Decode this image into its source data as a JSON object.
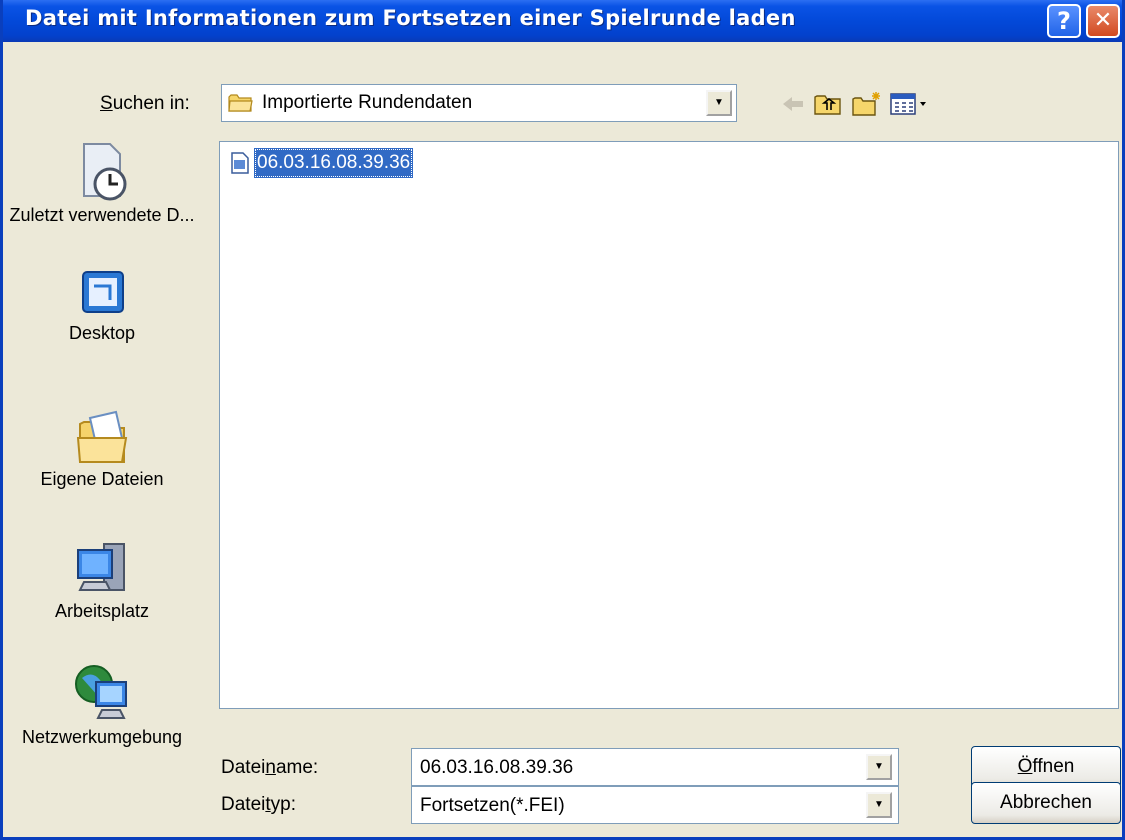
{
  "window": {
    "title": "Datei mit Informationen zum Fortsetzen einer Spielrunde laden",
    "help_label": "?",
    "close_label": "✕"
  },
  "lookin": {
    "label_pre": "",
    "label_key": "S",
    "label_post": "uchen in:",
    "value": "Importierte Rundendaten"
  },
  "toolbar": {
    "icons": [
      "back-arrow-icon",
      "up-one-level-icon",
      "new-folder-icon",
      "view-menu-icon"
    ]
  },
  "places": [
    {
      "label": "Zuletzt verwendete D...",
      "icon": "recent-documents-icon"
    },
    {
      "label": "Desktop",
      "icon": "desktop-icon"
    },
    {
      "label": "Eigene Dateien",
      "icon": "my-documents-icon"
    },
    {
      "label": "Arbeitsplatz",
      "icon": "my-computer-icon"
    },
    {
      "label": "Netzwerkumgebung",
      "icon": "network-icon"
    }
  ],
  "files": [
    {
      "name": "06.03.16.08.39.36",
      "selected": true
    }
  ],
  "filename": {
    "label_pre": "Datei",
    "label_key": "n",
    "label_post": "ame:",
    "value": "06.03.16.08.39.36"
  },
  "filetype": {
    "label_pre": "Datei",
    "label_key": "t",
    "label_post": "yp:",
    "value": "Fortsetzen(*.FEI)"
  },
  "buttons": {
    "open_pre": "",
    "open_key": "Ö",
    "open_post": "ffnen",
    "cancel": "Abbrechen"
  },
  "colors": {
    "title_bar": "#0349d9",
    "dialog_bg": "#ece9d8",
    "selection": "#316ac5"
  }
}
